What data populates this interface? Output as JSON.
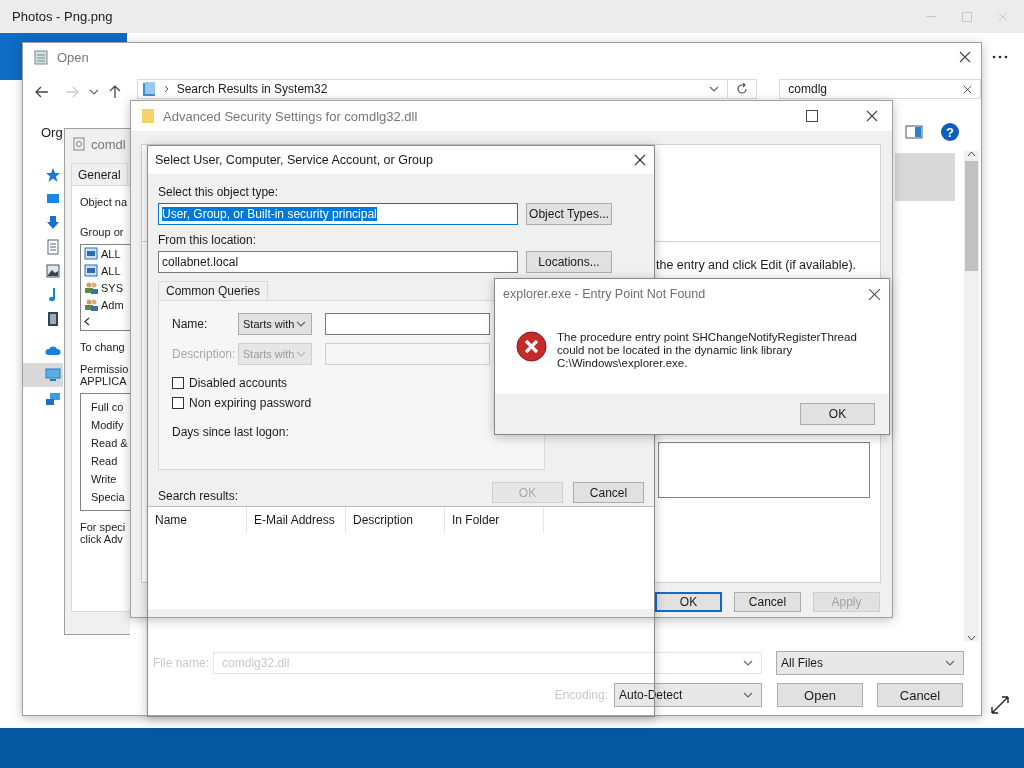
{
  "app_window": {
    "title": "Photos - Png.png"
  },
  "open_dialog": {
    "title": "Open",
    "address": "Search Results in System32",
    "search": {
      "value": "comdlg"
    },
    "toolbar_label": "Org",
    "help": "?",
    "nav_items": [
      {
        "kind": "star",
        "selected": false
      },
      {
        "kind": "desktop",
        "selected": false
      },
      {
        "kind": "downloads",
        "selected": false
      },
      {
        "kind": "documents",
        "selected": false
      },
      {
        "kind": "pictures",
        "selected": false
      },
      {
        "kind": "music",
        "selected": false
      },
      {
        "kind": "videos",
        "selected": false
      },
      {
        "kind": "cloud",
        "selected": false
      },
      {
        "kind": "computer",
        "selected": true
      },
      {
        "kind": "network",
        "selected": false
      }
    ],
    "file_name": {
      "label": "File name:",
      "value": "comdlg32.dll"
    },
    "file_type": "All Files",
    "encoding": {
      "label": "Encoding:",
      "value": "Auto-Detect"
    },
    "buttons": [
      "Open",
      "Cancel"
    ]
  },
  "properties_window": {
    "title": "comdl",
    "tabs": [
      {
        "label": "General",
        "selected": false
      }
    ],
    "object_label": "Object na",
    "group_label": "Group or",
    "groups": [
      {
        "kind": "package",
        "name": "ALL"
      },
      {
        "kind": "package",
        "name": "ALL"
      },
      {
        "kind": "users",
        "name": "SYS"
      },
      {
        "kind": "users",
        "name": "Adm"
      }
    ],
    "change_note": "To chang",
    "permissions_label": "Permissio\nAPPLICA",
    "permissions": [
      "Full co",
      "Modify",
      "Read &",
      "Read",
      "Write",
      "Specia"
    ],
    "special_note": "For speci\nclick Adv"
  },
  "advanced_window": {
    "title": "Advanced Security Settings for comdlg32.dll",
    "instruction": "the entry and click Edit (if available).",
    "buttons": [
      {
        "label": "OK",
        "focused": true,
        "disabled": false
      },
      {
        "label": "Cancel",
        "focused": false,
        "disabled": false
      },
      {
        "label": "Apply",
        "focused": false,
        "disabled": true
      }
    ]
  },
  "select_dialog": {
    "title": "Select User, Computer, Service Account, or Group",
    "object_type": {
      "label": "Select this object type:",
      "value": "User, Group, or Built-in security principal"
    },
    "object_types_button": "Object Types...",
    "location": {
      "label": "From this location:",
      "value": "collabnet.local"
    },
    "locations_button": "Locations...",
    "queries_tab": "Common Queries",
    "query_rows": [
      {
        "label": "Name:",
        "mode": "Starts with",
        "disabled": false
      },
      {
        "label": "Description:",
        "mode": "Starts with",
        "disabled": true
      }
    ],
    "checkboxes": [
      {
        "label": "Disabled accounts",
        "checked": false
      },
      {
        "label": "Non expiring password",
        "checked": false
      }
    ],
    "days_label": "Days since last logon:",
    "buttons": [
      {
        "label": "OK",
        "disabled": true
      },
      {
        "label": "Cancel",
        "disabled": false
      }
    ],
    "results_label": "Search results:",
    "columns": [
      "Name",
      "E-Mail Address",
      "Description",
      "In Folder"
    ]
  },
  "error_dialog": {
    "title": "explorer.exe - Entry Point Not Found",
    "message": "The procedure entry point SHChangeNotifyRegisterThread\ncould not be located in the dynamic link library\nC:\\Windows\\explorer.exe.",
    "button": "OK"
  }
}
